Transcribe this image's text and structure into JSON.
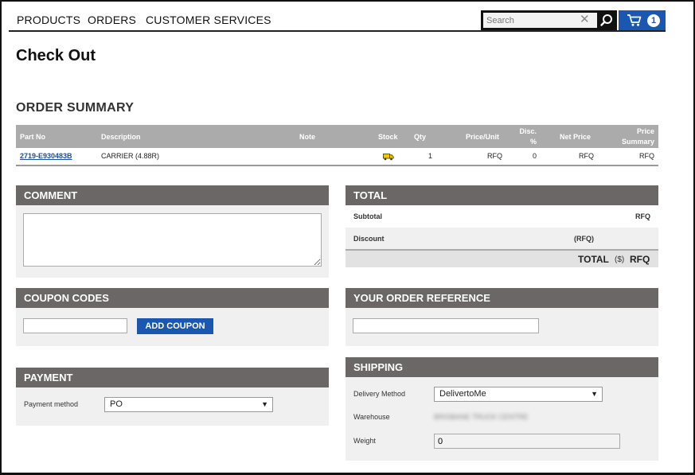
{
  "nav": {
    "products": "PRODUCTS",
    "orders": "ORDERS",
    "customer_services": "CUSTOMER SERVICES",
    "search_placeholder": "Search",
    "clear_glyph": "✕",
    "cart_count": "1"
  },
  "page": {
    "title": "Check Out",
    "summary_title": "ORDER SUMMARY"
  },
  "order_table": {
    "headers": {
      "part_no": "Part No",
      "description": "Description",
      "note": "Note",
      "stock": "Stock",
      "qty": "Qty",
      "price_unit": "Price/Unit",
      "disc_line1": "Disc.",
      "disc_line2": "%",
      "net_price": "Net Price",
      "price_summary_line1": "Price",
      "price_summary_line2": "Summary"
    },
    "rows": [
      {
        "part_no": "2719-E930483B",
        "description": "CARRIER (4.88R)",
        "note": "",
        "stock_icon": "truck-icon",
        "qty": "1",
        "price_unit": "RFQ",
        "disc": "0",
        "net_price": "RFQ",
        "price_summary": "RFQ"
      }
    ]
  },
  "comment": {
    "title": "COMMENT",
    "value": ""
  },
  "coupon": {
    "title": "COUPON CODES",
    "value": "",
    "button": "ADD COUPON"
  },
  "payment": {
    "title": "PAYMENT",
    "method_label": "Payment method",
    "method_value": "PO"
  },
  "total": {
    "title": "TOTAL",
    "subtotal_label": "Subtotal",
    "subtotal_value": "RFQ",
    "discount_label": "Discount",
    "discount_value": "(RFQ)",
    "total_label": "TOTAL",
    "currency": "($)",
    "total_value": "RFQ"
  },
  "order_reference": {
    "title": "YOUR ORDER REFERENCE",
    "value": ""
  },
  "shipping": {
    "title": "SHIPPING",
    "delivery_label": "Delivery Method",
    "delivery_value": "DelivertoMe",
    "warehouse_label": "Warehouse",
    "warehouse_value": "BRISBANE TRUCK CENTRE",
    "weight_label": "Weight",
    "weight_value": "0"
  },
  "colors": {
    "accent": "#1a57b0",
    "panel_header": "#6b6766",
    "table_header": "#ababab",
    "panel_bg": "#f0f0f0"
  }
}
